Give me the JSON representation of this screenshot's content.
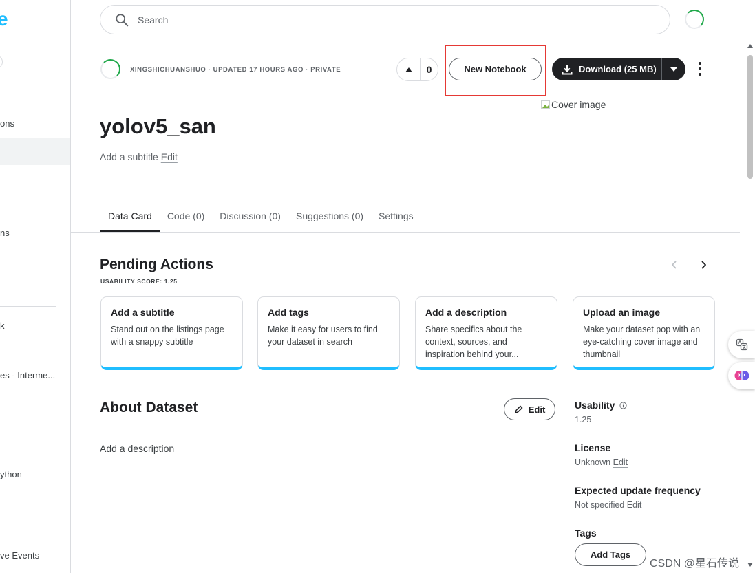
{
  "search": {
    "placeholder": "Search"
  },
  "sidebar": {
    "logo_fragment": "e",
    "items": [
      {
        "label": "ons"
      },
      {
        "label": "ns"
      },
      {
        "label": "k"
      },
      {
        "label": "es - Interme..."
      },
      {
        "label": "ython"
      },
      {
        "label": "ve Events"
      }
    ]
  },
  "dataset": {
    "meta": "XINGSHICHUANSHUO · UPDATED 17 HOURS AGO · PRIVATE",
    "title": "yolov5_san",
    "subtitle_prompt": "Add a subtitle",
    "edit_label": "Edit",
    "cover_alt": "Cover image"
  },
  "vote": {
    "count": "0"
  },
  "actions": {
    "new_notebook": "New Notebook",
    "download": "Download (25 MB)"
  },
  "tabs": [
    {
      "label": "Data Card"
    },
    {
      "label": "Code (0)"
    },
    {
      "label": "Discussion (0)"
    },
    {
      "label": "Suggestions (0)"
    },
    {
      "label": "Settings"
    }
  ],
  "pending": {
    "title": "Pending Actions",
    "usability_score": "USABILITY SCORE: 1.25",
    "cards": [
      {
        "title": "Add a subtitle",
        "body": "Stand out on the listings page with a snappy subtitle"
      },
      {
        "title": "Add tags",
        "body": "Make it easy for users to find your dataset in search"
      },
      {
        "title": "Add a description",
        "body": "Share specifics about the context, sources, and inspiration behind your..."
      },
      {
        "title": "Upload an image",
        "body": "Make your dataset pop with an eye-catching cover image and thumbnail"
      }
    ]
  },
  "about": {
    "title": "About Dataset",
    "edit_label": "Edit",
    "description_prompt": "Add a description"
  },
  "details": {
    "usability_label": "Usability",
    "usability_value": "1.25",
    "license_label": "License",
    "license_value": "Unknown",
    "license_edit": "Edit",
    "frequency_label": "Expected update frequency",
    "frequency_value": "Not specified",
    "frequency_edit": "Edit",
    "tags_label": "Tags",
    "add_tags": "Add Tags"
  },
  "watermark": "CSDN @星石传说",
  "colors": {
    "accent": "#20beff",
    "dark": "#202124",
    "highlight": "#e53935",
    "spinner": "#20a84a"
  }
}
